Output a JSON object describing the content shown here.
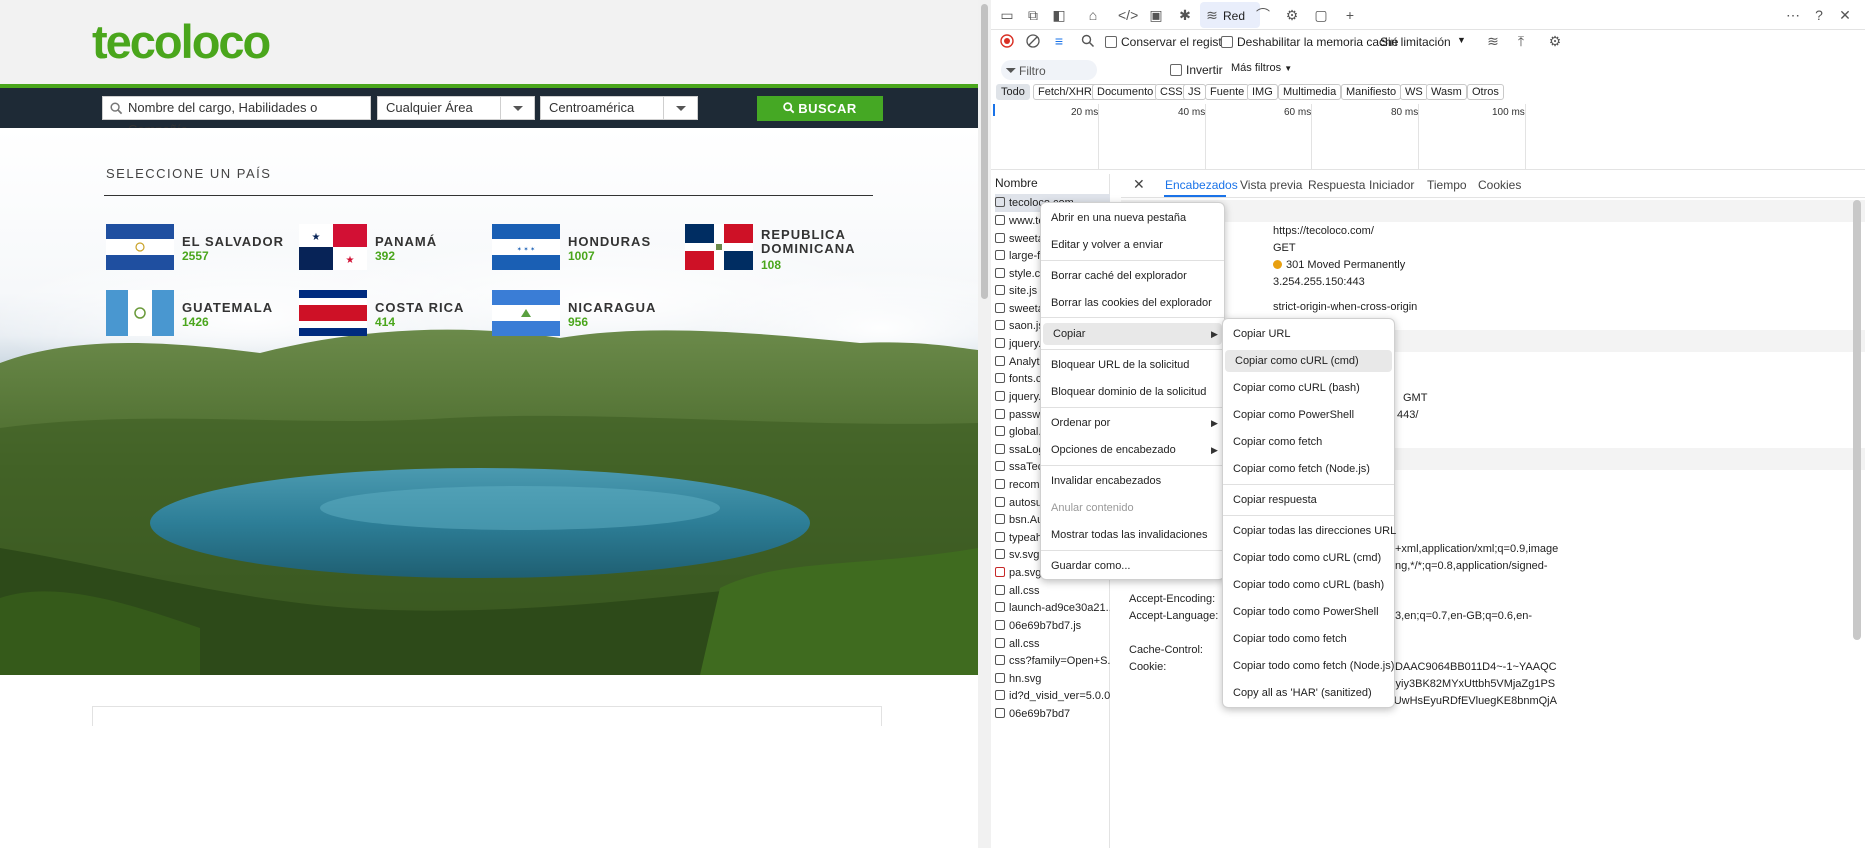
{
  "site": {
    "logo": "tecoloco",
    "search": {
      "keyword_placeholder": "Nombre del cargo, Habilidades o Compañía",
      "area_value": "Cualquier Área",
      "region_value": "Centroamérica",
      "button_label": "BUSCAR"
    },
    "select_country_title": "SELECCIONE UN PAÍS",
    "countries": [
      {
        "name": "EL SALVADOR",
        "count": "2557"
      },
      {
        "name": "PANAMÁ",
        "count": "392"
      },
      {
        "name": "HONDURAS",
        "count": "1007"
      },
      {
        "name_line1": "REPUBLICA",
        "name_line2": "DOMINICANA",
        "count": "108"
      },
      {
        "name": "GUATEMALA",
        "count": "1426"
      },
      {
        "name": "COSTA RICA",
        "count": "414"
      },
      {
        "name": "NICARAGUA",
        "count": "956"
      }
    ]
  },
  "devtools": {
    "active_panel": "Red",
    "toolbar2": {
      "preserve_log": "Conservar el registro",
      "disable_cache": "Deshabilitar la memoria caché",
      "throttling": "Sin limitación"
    },
    "filter": {
      "placeholder": "Filtro",
      "invert": "Invertir",
      "more_filters": "Más filtros"
    },
    "type_filters": [
      "Todo",
      "Fetch/XHR",
      "Documento",
      "CSS",
      "JS",
      "Fuente",
      "IMG",
      "Multimedia",
      "Manifiesto",
      "WS",
      "Wasm",
      "Otros"
    ],
    "timeline_labels": [
      "20 ms",
      "40 ms",
      "60 ms",
      "80 ms",
      "100 ms"
    ],
    "name_header": "Nombre",
    "requests": [
      "tecoloco.com",
      "www.tecoloco.com",
      "sweetalert.css",
      "large-flags.css",
      "style.css",
      "site.js",
      "sweetalert.js",
      "saon.js",
      "jquery.js",
      "Analytics.js",
      "fonts.css",
      "jquery.ui.js",
      "password.js",
      "global.js",
      "ssaLogin.js",
      "ssaTecoloco.js",
      "recommend.js",
      "autosuggest.js",
      "bsn.AutoSuggest.js",
      "typeahead.js",
      "sv.svg",
      "pa.svg",
      "all.css",
      "launch-ad9ce30a21...",
      "06e69b7bd7.js",
      "all.css",
      "css?family=Open+S...",
      "hn.svg",
      "id?d_visid_ver=5.0.0...",
      "06e69b7bd7"
    ],
    "detail_tabs": [
      "Encabezados",
      "Vista previa",
      "Respuesta",
      "Iniciador",
      "Tiempo",
      "Cookies"
    ],
    "general": {
      "url": "https://tecoloco.com/",
      "method": "GET",
      "status": "301 Moved Permanently",
      "remote": "3.254.255.150:443",
      "referrer_policy": "strict-origin-when-cross-origin"
    },
    "fragments": {
      "gmt": "GMT",
      "port": "443/",
      "accept_1": "+xml,application/xml;q=0.9,image",
      "accept_2": "ng,*/*;q=0.8,application/signed-",
      "lang_1": "3,en;q=0.7,en-GB;q=0.6,en-",
      "cookie_1": "CDAAC9064BB011D4~-1~YAAQC",
      "cookie_2": "Qyiy3BK82MYxUttbh5VMjaZg1PS",
      "cookie_3": "ZUwHsEyuRDfEVluegKE8bnmQjA"
    },
    "header_names": {
      "accept_encoding": "Accept-Encoding:",
      "accept_language": "Accept-Language:",
      "cache_control": "Cache-Control:",
      "cookie": "Cookie:"
    },
    "context_menu": [
      "Abrir en una nueva pestaña",
      "Editar y volver a enviar",
      "Borrar caché del explorador",
      "Borrar las cookies del explorador",
      "Copiar",
      "Bloquear URL de la solicitud",
      "Bloquear dominio de la solicitud",
      "Ordenar por",
      "Opciones de encabezado",
      "Invalidar encabezados",
      "Anular contenido",
      "Mostrar todas las invalidaciones",
      "Guardar como..."
    ],
    "copy_submenu": [
      "Copiar URL",
      "Copiar como cURL (cmd)",
      "Copiar como cURL (bash)",
      "Copiar como PowerShell",
      "Copiar como fetch",
      "Copiar como fetch (Node.js)",
      "Copiar respuesta",
      "Copiar todas las direcciones URL",
      "Copiar todo como cURL (cmd)",
      "Copiar todo como cURL (bash)",
      "Copiar todo como PowerShell",
      "Copiar todo como fetch",
      "Copiar todo como fetch (Node.js)",
      "Copy all as 'HAR' (sanitized)"
    ]
  }
}
